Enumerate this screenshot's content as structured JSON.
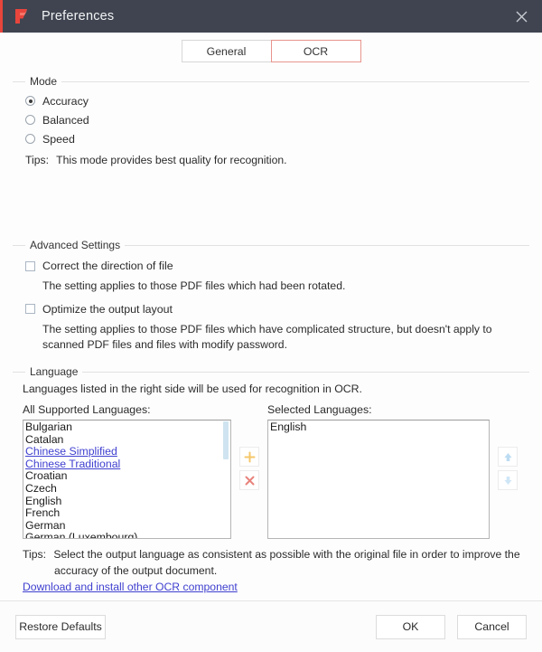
{
  "window": {
    "title": "Preferences",
    "logo_icon": "foxit-f-logo-icon",
    "close_icon": "close-icon",
    "accent_color": "#e8453c",
    "titlebar_color": "#3f4450"
  },
  "tabs": [
    {
      "label": "General",
      "active": false
    },
    {
      "label": "OCR",
      "active": true
    }
  ],
  "mode": {
    "legend": "Mode",
    "options": [
      {
        "label": "Accuracy",
        "selected": true
      },
      {
        "label": "Balanced",
        "selected": false
      },
      {
        "label": "Speed",
        "selected": false
      }
    ],
    "tips_label": "Tips:",
    "tips_text": "This mode provides best quality for recognition."
  },
  "advanced": {
    "legend": "Advanced Settings",
    "items": [
      {
        "label": "Correct the direction of file",
        "checked": false,
        "description": "The setting applies to those PDF files which had been rotated."
      },
      {
        "label": "Optimize the output layout",
        "checked": false,
        "description": "The setting applies to those PDF files which have complicated structure, but doesn't apply to scanned PDF files and files with modify password."
      }
    ]
  },
  "language": {
    "legend": "Language",
    "intro": "Languages listed in the right side will be used for recognition in OCR.",
    "all_caption": "All Supported Languages:",
    "selected_caption": "Selected Languages:",
    "all_languages": [
      {
        "name": "Bulgarian",
        "link": false
      },
      {
        "name": "Catalan",
        "link": false
      },
      {
        "name": "Chinese Simplified",
        "link": true
      },
      {
        "name": "Chinese Traditional",
        "link": true
      },
      {
        "name": "Croatian",
        "link": false
      },
      {
        "name": "Czech",
        "link": false
      },
      {
        "name": "English",
        "link": false
      },
      {
        "name": "French",
        "link": false
      },
      {
        "name": "German",
        "link": false
      },
      {
        "name": "German (Luxembourg)",
        "link": false
      }
    ],
    "selected_languages": [
      "English"
    ],
    "add_icon": "plus-icon",
    "remove_icon": "cross-icon",
    "move_up_icon": "arrow-up-icon",
    "move_down_icon": "arrow-down-icon",
    "add_color": "#f5c76a",
    "remove_color": "#e8837c",
    "arrow_color": "#bcdcf2"
  },
  "bottom": {
    "tips_label": "Tips:",
    "tips_line1": "Select the output language as consistent as possible with the original file in order to improve the",
    "tips_line2": "accuracy of the output document.",
    "download_link": "Download and install other OCR component"
  },
  "footer": {
    "restore": "Restore Defaults",
    "ok": "OK",
    "cancel": "Cancel"
  }
}
